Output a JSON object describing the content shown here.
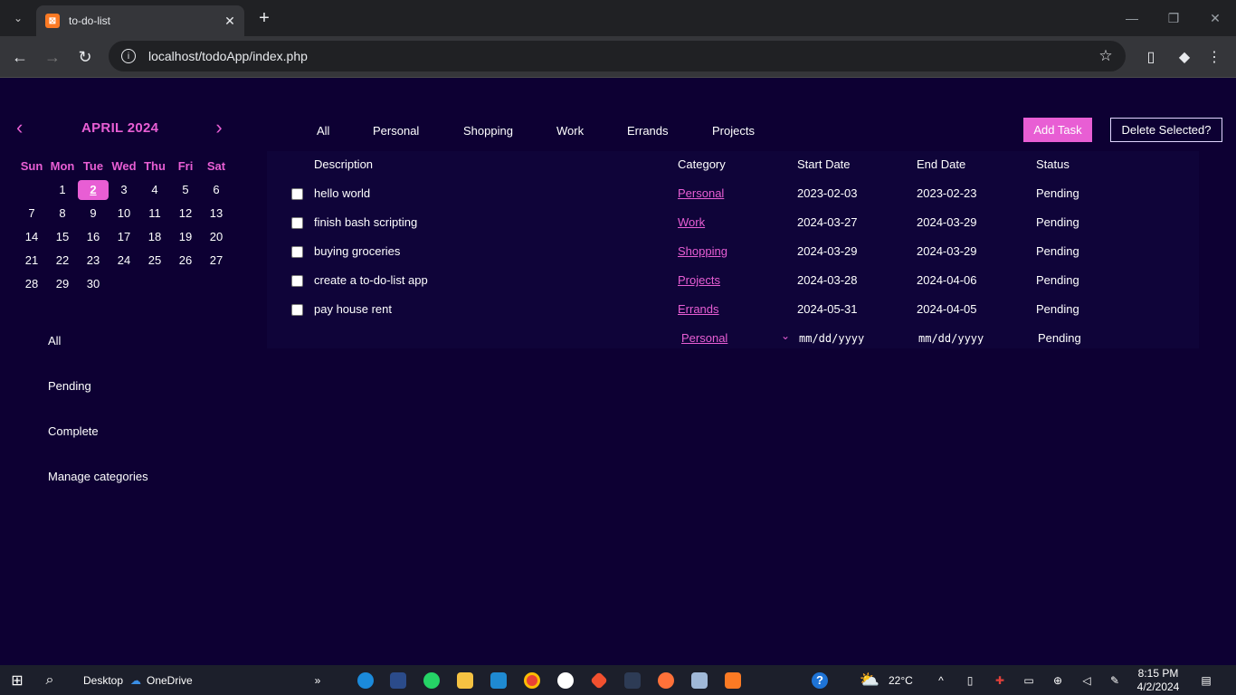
{
  "browser": {
    "tab_title": "to-do-list",
    "tab_icon": "xampp-icon",
    "url": "localhost/todoApp/index.php"
  },
  "calendar": {
    "prev": "‹",
    "next": "›",
    "title": "APRIL 2024",
    "weekdays": [
      "Sun",
      "Mon",
      "Tue",
      "Wed",
      "Thu",
      "Fri",
      "Sat"
    ],
    "weeks": [
      [
        "",
        "1",
        "2",
        "3",
        "4",
        "5",
        "6"
      ],
      [
        "7",
        "8",
        "9",
        "10",
        "11",
        "12",
        "13"
      ],
      [
        "14",
        "15",
        "16",
        "17",
        "18",
        "19",
        "20"
      ],
      [
        "21",
        "22",
        "23",
        "24",
        "25",
        "26",
        "27"
      ],
      [
        "28",
        "29",
        "30",
        "",
        "",
        "",
        ""
      ]
    ],
    "today": "2"
  },
  "filters": [
    "All",
    "Pending",
    "Complete",
    "Manage categories"
  ],
  "category_tabs": [
    "All",
    "Personal",
    "Shopping",
    "Work",
    "Errands",
    "Projects"
  ],
  "actions": {
    "add_task": "Add Task",
    "delete_selected": "Delete Selected?"
  },
  "table": {
    "headers": {
      "description": "Description",
      "category": "Category",
      "start_date": "Start Date",
      "end_date": "End Date",
      "status": "Status"
    },
    "rows": [
      {
        "description": "hello world",
        "category": "Personal",
        "start": "2023-02-03",
        "end": "2023-02-23",
        "status": "Pending"
      },
      {
        "description": "finish bash scripting",
        "category": "Work",
        "start": "2024-03-27",
        "end": "2024-03-29",
        "status": "Pending"
      },
      {
        "description": "buying groceries",
        "category": "Shopping",
        "start": "2024-03-29",
        "end": "2024-03-29",
        "status": "Pending"
      },
      {
        "description": "create a to-do-list app",
        "category": "Projects",
        "start": "2024-03-28",
        "end": "2024-04-06",
        "status": "Pending"
      },
      {
        "description": "pay house rent",
        "category": "Errands",
        "start": "2024-05-31",
        "end": "2024-04-05",
        "status": "Pending"
      }
    ],
    "new_row": {
      "category": "Personal",
      "start_placeholder": "mm/dd/yyyy",
      "end_placeholder": "mm/dd/yyyy",
      "status": "Pending"
    }
  },
  "taskbar": {
    "desktop": "Desktop",
    "onedrive": "OneDrive",
    "temperature": "22°C",
    "time": "8:15 PM",
    "date": "4/2/2024"
  },
  "colors": {
    "background": "#0d0033",
    "accent": "#e85ed4",
    "table_bg": "#0f0439"
  }
}
